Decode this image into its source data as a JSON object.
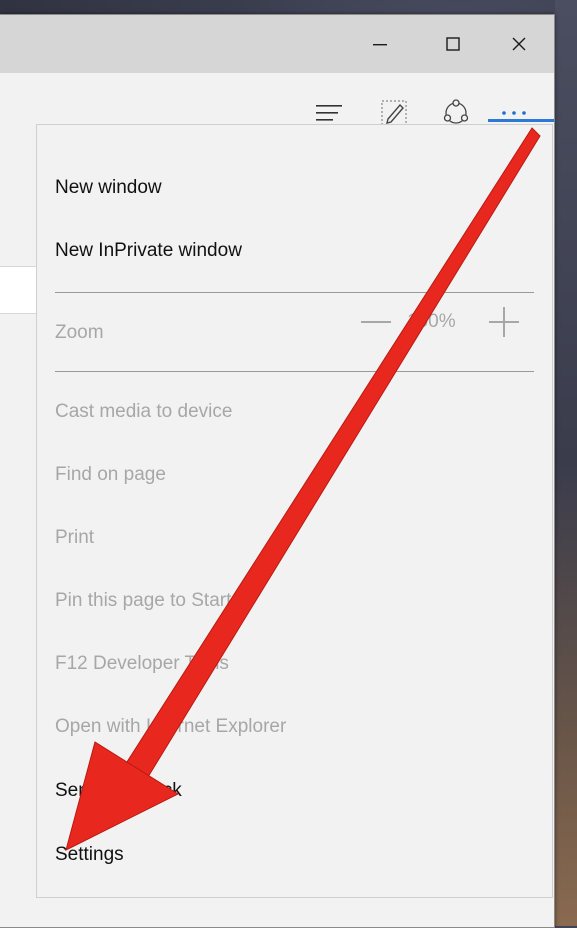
{
  "window": {
    "caption_buttons": {
      "minimize": "minimize-icon",
      "maximize": "maximize-icon",
      "close": "close-icon"
    }
  },
  "toolbar": {
    "icons": [
      "hub-icon",
      "web-note-icon",
      "share-icon",
      "more-actions-icon"
    ],
    "accent_color": "#2c7ad6"
  },
  "menu": {
    "new_window": "New window",
    "new_inprivate": "New InPrivate window",
    "zoom_label": "Zoom",
    "zoom_value": "100%",
    "cast": "Cast media to device",
    "find": "Find on page",
    "print": "Print",
    "pin": "Pin this page to Start",
    "devtools": "F12 Developer Tools",
    "open_ie": "Open with Internet Explorer",
    "feedback": "Send feedback",
    "settings": "Settings"
  },
  "annotation": {
    "arrow_color": "#e8281e"
  }
}
